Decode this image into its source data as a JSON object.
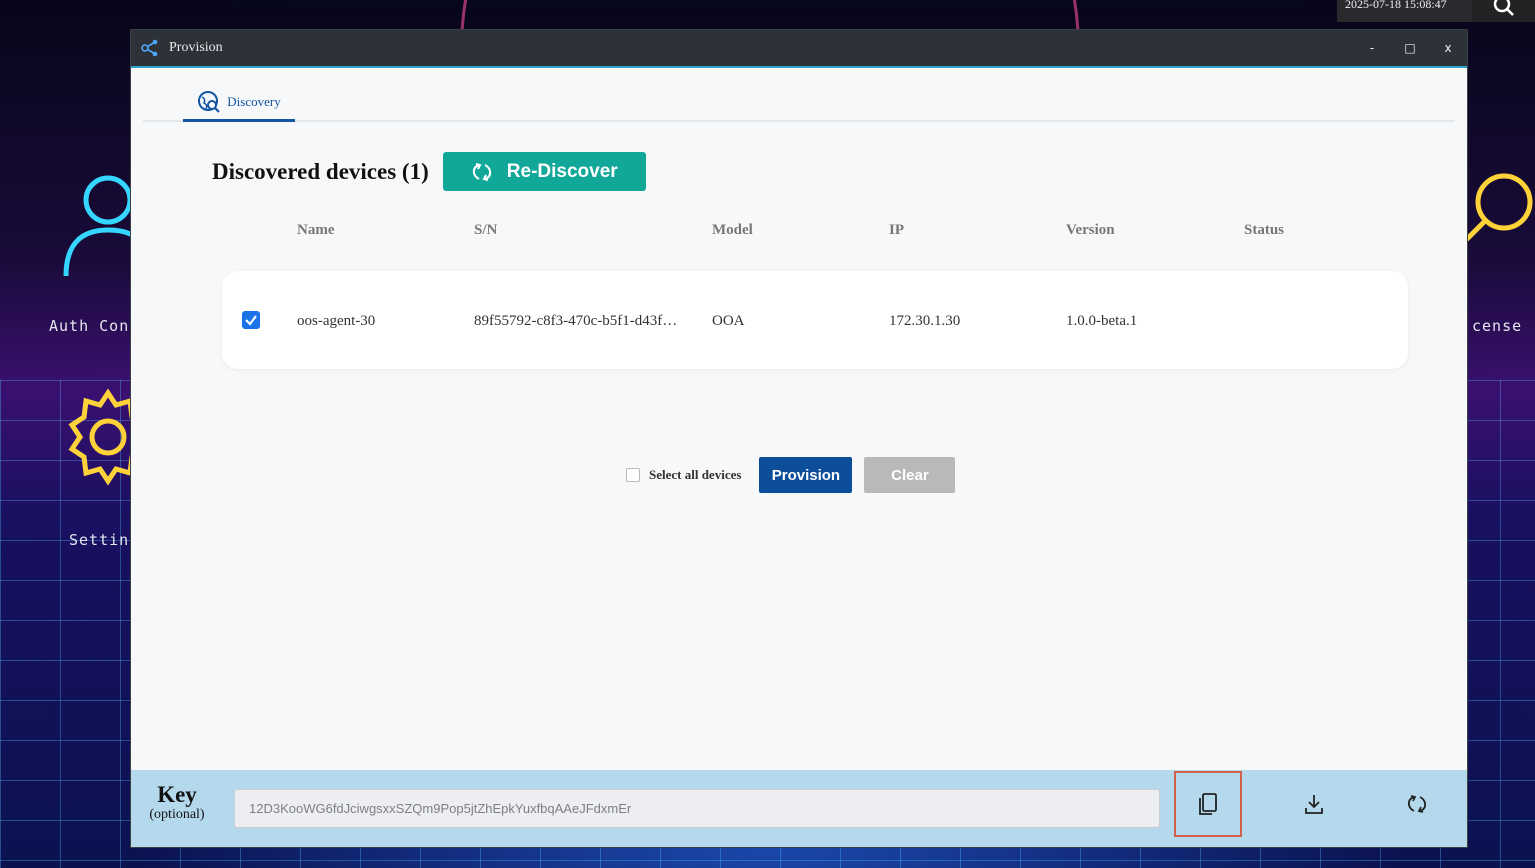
{
  "desktop": {
    "clock": "2025-07-18 15:08:47",
    "icons": [
      {
        "label": "Auth Con",
        "icon": "user-icon"
      },
      {
        "label": "Settin",
        "icon": "gear-icon"
      },
      {
        "label": "cense",
        "icon": "key-icon"
      }
    ]
  },
  "window": {
    "title": "Provision",
    "controls": {
      "minimize": "-",
      "maximize": "□",
      "close": "x"
    }
  },
  "tabs": [
    {
      "label": "Discovery",
      "icon": "globe-search-icon",
      "active": true
    }
  ],
  "discovery": {
    "heading": "Discovered devices (1)",
    "rediscover_label": "Re-Discover",
    "columns": [
      "Name",
      "S/N",
      "Model",
      "IP",
      "Version",
      "Status"
    ],
    "rows": [
      {
        "checked": true,
        "name": "oos-agent-30",
        "sn": "89f55792-c8f3-470c-b5f1-d43f…",
        "model": "OOA",
        "ip": "172.30.1.30",
        "version": "1.0.0-beta.1",
        "status": ""
      }
    ],
    "select_all_label": "Select all devices",
    "provision_label": "Provision",
    "clear_label": "Clear"
  },
  "keybar": {
    "label": "Key",
    "sublabel": "(optional)",
    "value": "12D3KooWG6fdJciwgsxxSZQm9Pop5jtZhEpkYuxfbqAAeJFdxmEr",
    "buttons": [
      "copy-icon",
      "download-icon",
      "refresh-icon"
    ]
  },
  "colors": {
    "accent_teal": "#11a89a",
    "primary_blue": "#0d4e9b",
    "keybar_bg": "#b5d9ec",
    "highlight": "#d4604a"
  }
}
